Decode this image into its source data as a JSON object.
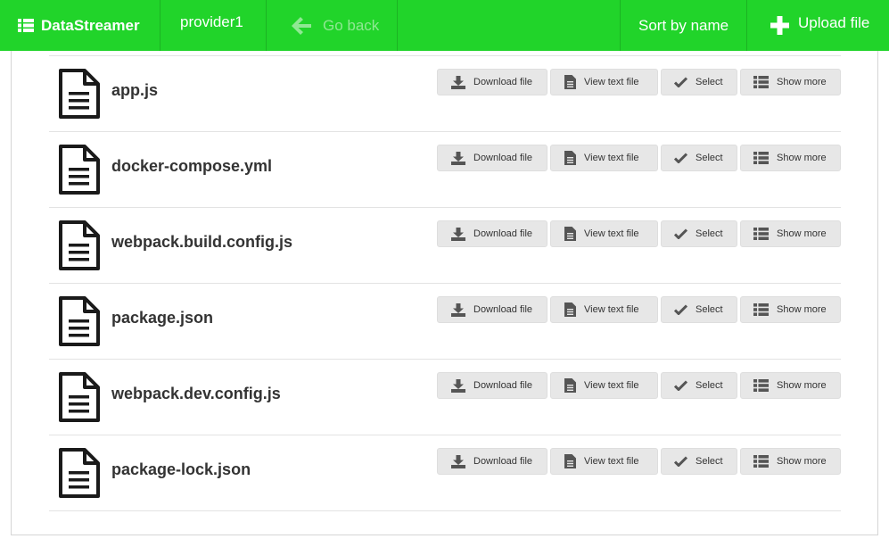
{
  "nav": {
    "brand": "DataStreamer",
    "provider": "provider1",
    "back": "Go back",
    "sort": "Sort by name",
    "upload": "Upload file"
  },
  "buttons": {
    "download": "Download file",
    "view": "View text file",
    "select": "Select",
    "more": "Show more"
  },
  "files": [
    {
      "name": "app.js"
    },
    {
      "name": "docker-compose.yml"
    },
    {
      "name": "webpack.build.config.js"
    },
    {
      "name": "package.json"
    },
    {
      "name": "webpack.dev.config.js"
    },
    {
      "name": "package-lock.json"
    }
  ],
  "colors": {
    "topbar": "#21d42a",
    "button_bg": "#e7e7e7"
  }
}
